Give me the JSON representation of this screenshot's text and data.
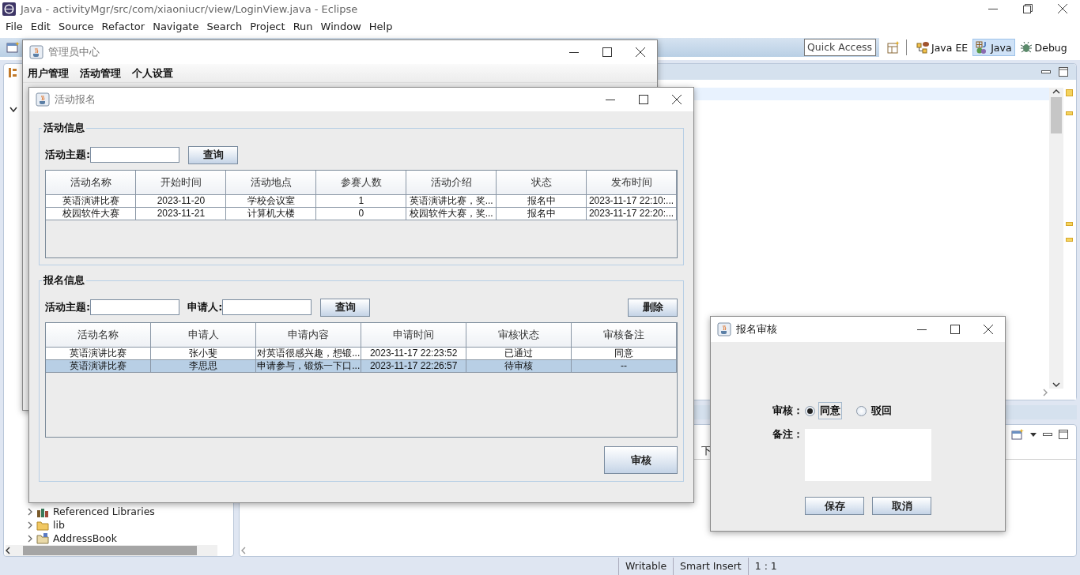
{
  "eclipse": {
    "title": "Java - activityMgr/src/com/xiaoniucr/view/LoginView.java - Eclipse",
    "menu": [
      "File",
      "Edit",
      "Source",
      "Refactor",
      "Navigate",
      "Search",
      "Project",
      "Run",
      "Window",
      "Help"
    ],
    "quick_access": {
      "placeholder": "Quick Access"
    },
    "perspectives": [
      {
        "label": "Java EE",
        "selected": false
      },
      {
        "label": "Java",
        "selected": true
      },
      {
        "label": "Debug",
        "selected": false
      }
    ],
    "explorer_items": [
      {
        "label": "Referenced Libraries",
        "kind": "library"
      },
      {
        "label": "lib",
        "kind": "folder"
      },
      {
        "label": "AddressBook",
        "kind": "project"
      }
    ],
    "console_tab": "下",
    "status_bar": [
      "Writable",
      "Smart Insert",
      "1 : 1"
    ]
  },
  "admin_window": {
    "title": "管理员中心",
    "menu": [
      "用户管理",
      "活动管理",
      "个人设置"
    ]
  },
  "signup_window": {
    "title": "活动报名",
    "activity_section": {
      "legend": "活动信息",
      "topic_label": "活动主题:",
      "search_button": "查询",
      "table": {
        "columns": [
          "活动名称",
          "开始时间",
          "活动地点",
          "参赛人数",
          "活动介绍",
          "状态",
          "发布时间"
        ],
        "rows": [
          {
            "cells": [
              "英语演讲比赛",
              "2023-11-20",
              "学校会议室",
              "1",
              "英语演讲比赛，奖...",
              "报名中",
              "2023-11-17 22:10:..."
            ],
            "selected": false
          },
          {
            "cells": [
              "校园软件大赛",
              "2023-11-21",
              "计算机大楼",
              "0",
              "校园软件大赛，奖...",
              "报名中",
              "2023-11-17 22:20:..."
            ],
            "selected": false
          }
        ]
      }
    },
    "signup_section": {
      "legend": "报名信息",
      "topic_label": "活动主题:",
      "applicant_label": "申请人:",
      "search_button": "查询",
      "delete_button": "删除",
      "table": {
        "columns": [
          "活动名称",
          "申请人",
          "申请内容",
          "申请时间",
          "审核状态",
          "审核备注"
        ],
        "rows": [
          {
            "cells": [
              "英语演讲比赛",
              "张小斐",
              "对英语很感兴趣，想锻...",
              "2023-11-17 22:23:52",
              "已通过",
              "同意"
            ],
            "selected": false
          },
          {
            "cells": [
              "英语演讲比赛",
              "李思思",
              "申请参与，锻炼一下口...",
              "2023-11-17 22:26:57",
              "待审核",
              "--"
            ],
            "selected": true
          }
        ]
      }
    },
    "review_button": "审核"
  },
  "review_dialog": {
    "title": "报名审核",
    "review_label": "审核：",
    "options": [
      {
        "label": "同意",
        "selected": true
      },
      {
        "label": "驳回",
        "selected": false
      }
    ],
    "remark_label": "备注：",
    "save_button": "保存",
    "cancel_button": "取消"
  }
}
